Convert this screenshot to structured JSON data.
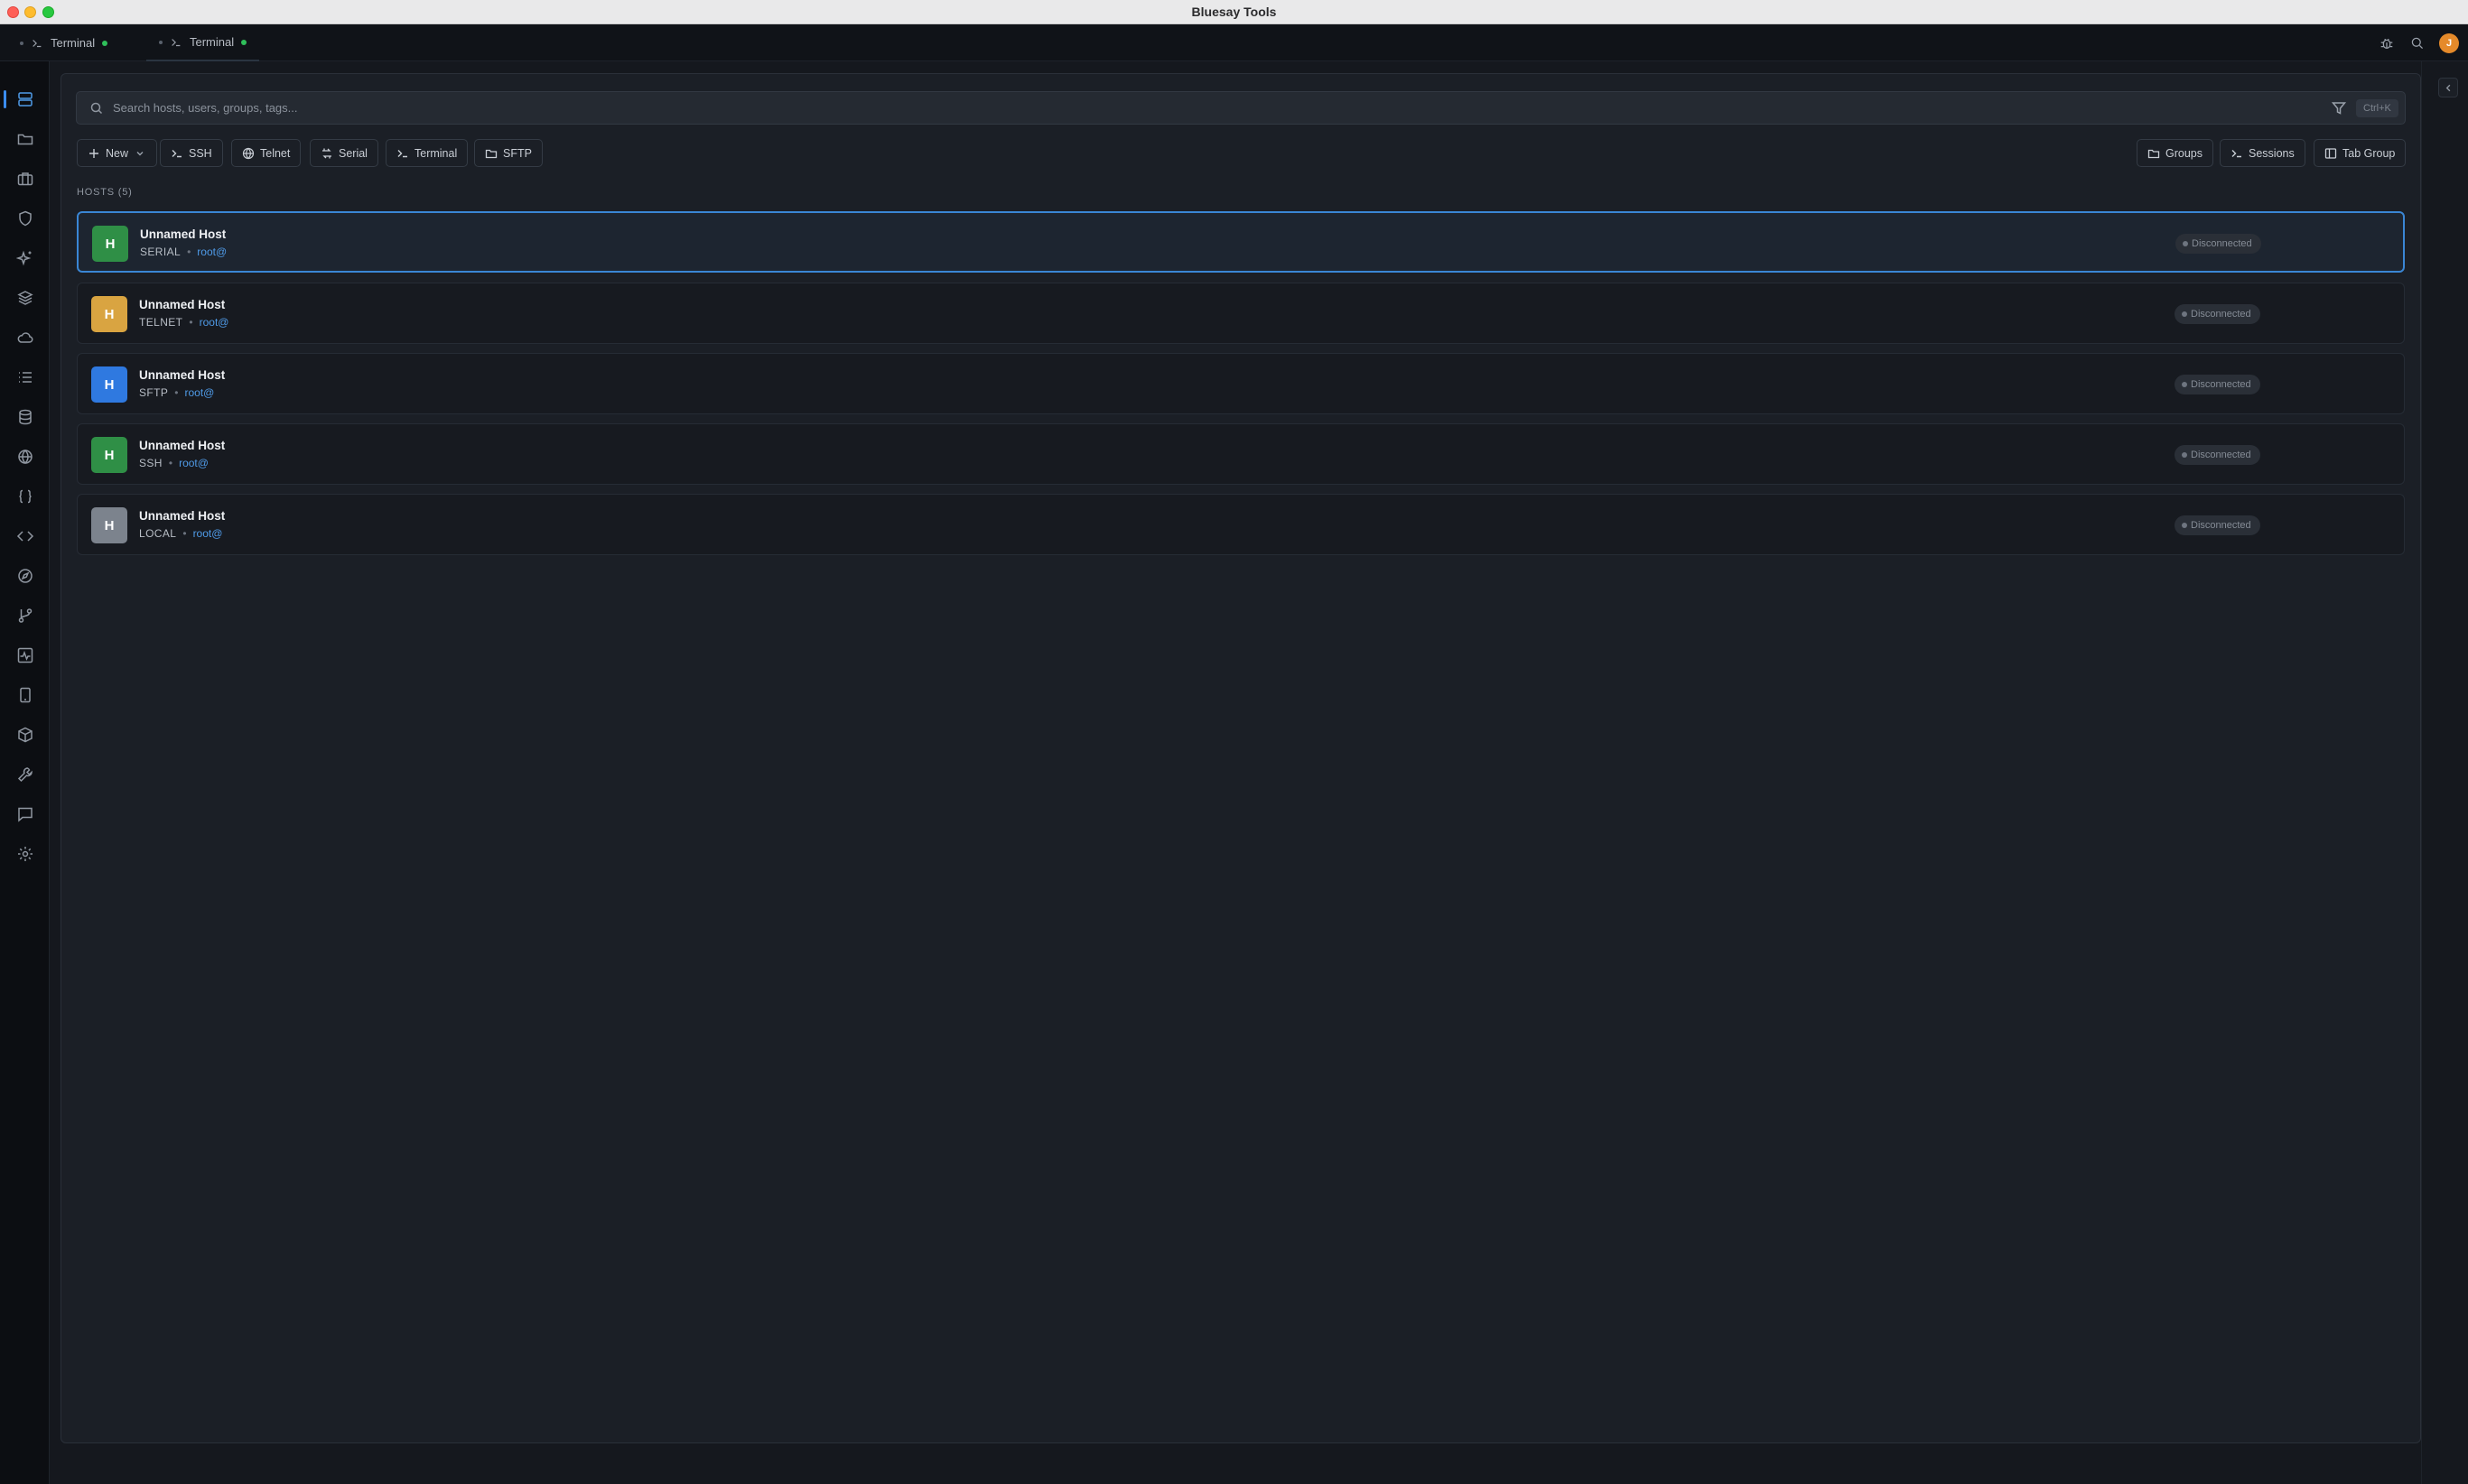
{
  "window": {
    "title": "Bluesay Tools"
  },
  "tabs": [
    {
      "label": "Terminal"
    },
    {
      "label": "Terminal"
    }
  ],
  "header_icons": [
    "bug-icon",
    "search-icon"
  ],
  "user": {
    "initial": "J",
    "color": "#e58a2a"
  },
  "activitybar": [
    "hosts-icon",
    "folder-icon",
    "briefcase-icon",
    "shield-icon",
    "sparkles-icon",
    "layers-icon",
    "cloud-icon",
    "list-icon",
    "database-icon",
    "globe-icon",
    "braces-icon",
    "code-icon",
    "compass-icon",
    "git-branch-icon",
    "activity-icon",
    "tablet-icon",
    "package-icon",
    "wrench-icon",
    "chat-icon",
    "settings-icon"
  ],
  "search": {
    "placeholder": "Search hosts, users, groups, tags...",
    "shortcut": "Ctrl+K"
  },
  "toolbar": {
    "new_label": "New",
    "ssh_label": "SSH",
    "telnet_label": "Telnet",
    "serial_label": "Serial",
    "terminal_label": "Terminal",
    "sftp_label": "SFTP",
    "groups_label": "Groups",
    "sessions_label": "Sessions",
    "tabgroup_label": "Tab Group"
  },
  "hosts": {
    "section_label": "HOSTS (5)",
    "items": [
      {
        "initial": "H",
        "name": "Unnamed Host",
        "protocol": "SERIAL",
        "user": "root@",
        "status": "Disconnected",
        "color": "#2f8f46",
        "selected": true
      },
      {
        "initial": "H",
        "name": "Unnamed Host",
        "protocol": "TELNET",
        "user": "root@",
        "status": "Disconnected",
        "color": "#d9a441",
        "selected": false
      },
      {
        "initial": "H",
        "name": "Unnamed Host",
        "protocol": "SFTP",
        "user": "root@",
        "status": "Disconnected",
        "color": "#2f79e0",
        "selected": false
      },
      {
        "initial": "H",
        "name": "Unnamed Host",
        "protocol": "SSH",
        "user": "root@",
        "status": "Disconnected",
        "color": "#2f8f46",
        "selected": false
      },
      {
        "initial": "H",
        "name": "Unnamed Host",
        "protocol": "LOCAL",
        "user": "root@",
        "status": "Disconnected",
        "color": "#7c838d",
        "selected": false
      }
    ]
  }
}
